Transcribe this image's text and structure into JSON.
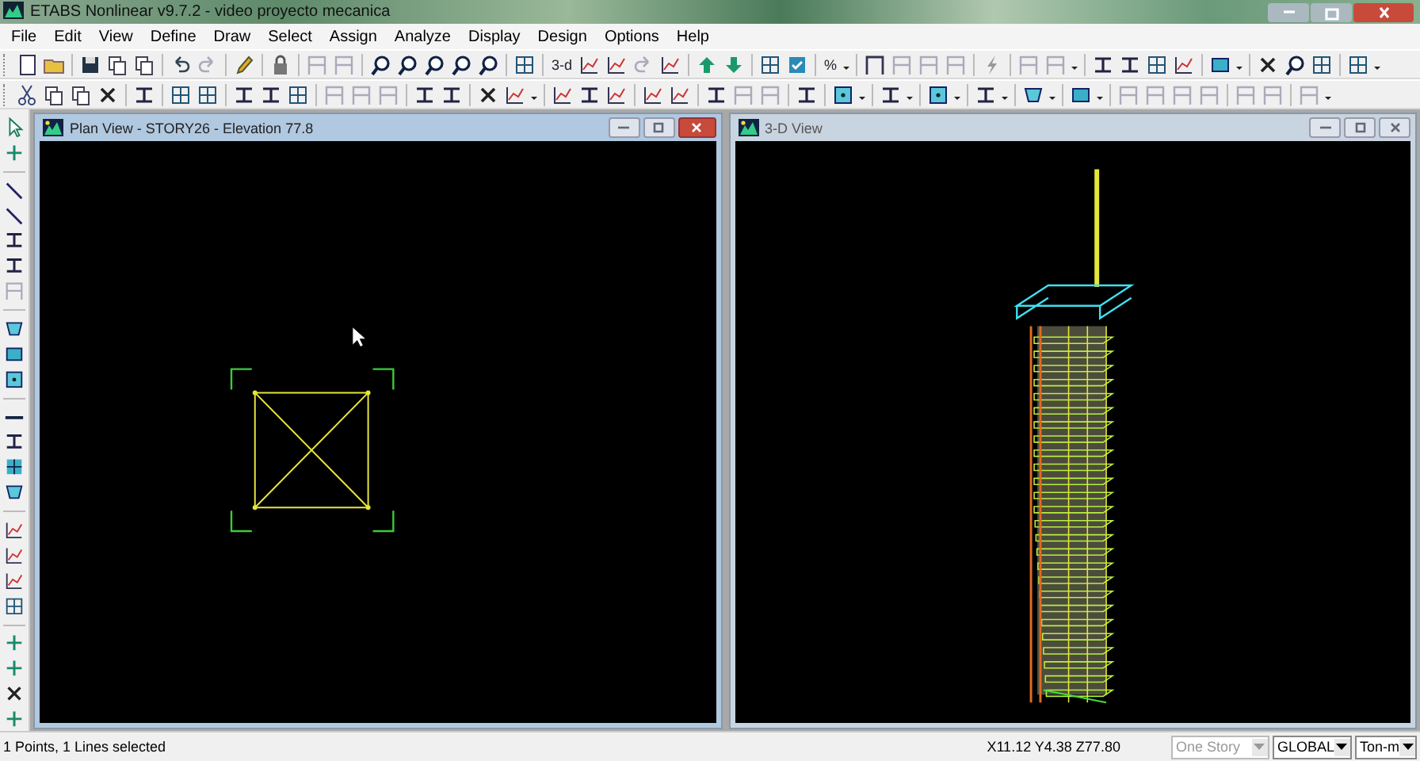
{
  "window": {
    "title": "ETABS Nonlinear v9.7.2 - video proyecto mecanica"
  },
  "menu": [
    "File",
    "Edit",
    "View",
    "Define",
    "Draw",
    "Select",
    "Assign",
    "Analyze",
    "Display",
    "Design",
    "Options",
    "Help"
  ],
  "toolbar": {
    "text_buttons": [
      "3-d",
      "%"
    ]
  },
  "child_windows": [
    {
      "title": "Plan View - STORY26 - Elevation 77.8",
      "active": true,
      "kind": "plan"
    },
    {
      "title": "3-D View",
      "active": false,
      "kind": "perspective"
    }
  ],
  "status_bar": {
    "message": "1 Points, 1 Lines selected",
    "coordinates": "X11.12  Y4.38  Z77.80",
    "dropdowns": [
      {
        "value": "One Story",
        "disabled": true
      },
      {
        "value": "GLOBAL",
        "disabled": false
      },
      {
        "value": "Ton-m",
        "disabled": false
      }
    ]
  }
}
